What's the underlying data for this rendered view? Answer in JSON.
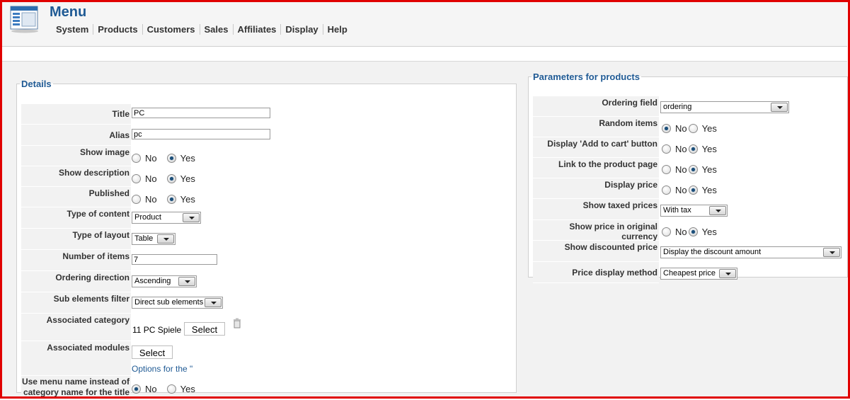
{
  "header": {
    "title": "Menu",
    "nav": [
      "System",
      "Products",
      "Customers",
      "Sales",
      "Affiliates",
      "Display",
      "Help"
    ]
  },
  "details": {
    "legend": "Details",
    "title_label": "Title",
    "title_value": "PC",
    "alias_label": "Alias",
    "alias_value": "pc",
    "show_image_label": "Show image",
    "show_description_label": "Show description",
    "published_label": "Published",
    "type_of_content_label": "Type of content",
    "type_of_content_value": "Product",
    "type_of_layout_label": "Type of layout",
    "type_of_layout_value": "Table",
    "number_of_items_label": "Number of items",
    "number_of_items_value": "7",
    "ordering_direction_label": "Ordering direction",
    "ordering_direction_value": "Ascending",
    "sub_elements_filter_label": "Sub elements filter",
    "sub_elements_filter_value": "Direct sub elements",
    "associated_category_label": "Associated category",
    "associated_category_value": "11 PC Spiele",
    "select_label": "Select",
    "associated_modules_label": "Associated modules",
    "options_link": "Options for the \"",
    "use_menu_name_label_1": "Use menu name instead of",
    "use_menu_name_label_2": "category name for the title"
  },
  "radio": {
    "no": "No",
    "yes": "Yes"
  },
  "params": {
    "legend": "Parameters for products",
    "ordering_field_label": "Ordering field",
    "ordering_field_value": "ordering",
    "random_items_label": "Random items",
    "add_to_cart_label": "Display 'Add to cart' button",
    "link_product_label": "Link to the product page",
    "display_price_label": "Display price",
    "show_taxed_label": "Show taxed prices",
    "show_taxed_value": "With tax",
    "original_currency_label": "Show price in original currency",
    "discounted_label": "Show discounted price",
    "discounted_value": "Display the discount amount",
    "price_method_label": "Price display method",
    "price_method_value": "Cheapest price"
  },
  "colors": {
    "accent": "#1f5a94",
    "frame": "#e00000"
  }
}
